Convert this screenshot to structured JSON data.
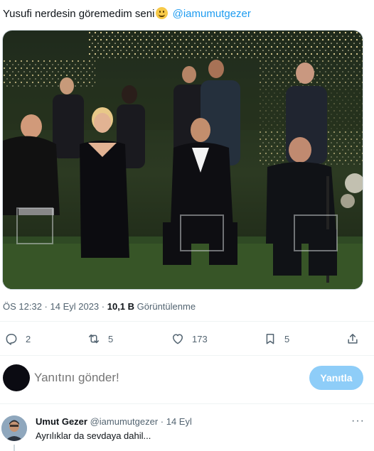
{
  "tweet": {
    "text": "Yusufi nerdesin göremedim seni",
    "emoji": "smiling-face-emoji",
    "mention": "@iamumutgezer"
  },
  "meta": {
    "time": "ÖS 12:32",
    "separator": " · ",
    "date": "14 Eyl 2023",
    "views_count": "10,1 B",
    "views_label": "Görüntülenme"
  },
  "actions": {
    "replies": "2",
    "retweets": "5",
    "likes": "173",
    "bookmarks": "5"
  },
  "reply_box": {
    "placeholder": "Yanıtını gönder!",
    "button_label": "Yanıtla"
  },
  "comment": {
    "name": "Umut Gezer",
    "handle": "@iamumutgezer",
    "separator": " · ",
    "date": "14 Eyl",
    "text": "Ayrılıklar da sevdaya dahil...",
    "more": "···"
  },
  "colors": {
    "accent": "#1d9bf0",
    "reply_button": "#8ecdf8",
    "secondary_text": "#536471",
    "divider": "#eff3f4"
  }
}
